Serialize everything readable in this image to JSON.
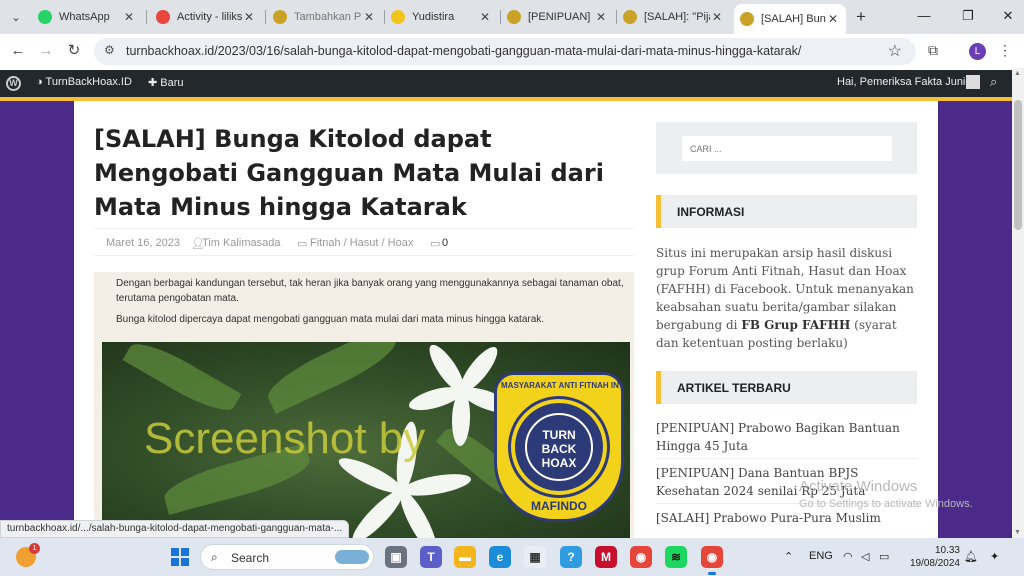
{
  "browser": {
    "tabs": [
      {
        "title": "WhatsApp",
        "favicon_color": "#25d366",
        "active": false
      },
      {
        "title": "Activity - liliks",
        "favicon_color": "#e8453c",
        "active": false
      },
      {
        "title": "Tambahkan P",
        "favicon_color": "#c9a227",
        "active": false
      },
      {
        "title": "Yudistira",
        "favicon_color": "#f2c31b",
        "active": false
      },
      {
        "title": "[PENIPUAN] P",
        "favicon_color": "#c9a227",
        "active": false
      },
      {
        "title": "[SALAH]: \"Pija",
        "favicon_color": "#c9a227",
        "active": false
      },
      {
        "title": "[SALAH] Bung",
        "favicon_color": "#c9a227",
        "active": true
      }
    ],
    "url": "turnbackhoax.id/2023/03/16/salah-bunga-kitolod-dapat-mengobati-gangguan-mata-mulai-dari-mata-minus-hingga-katarak/",
    "profile_initial": "L",
    "status_url": "turnbackhoax.id/.../salah-bunga-kitolod-dapat-mengobati-gangguan-mata-..."
  },
  "adminbar": {
    "site": "TurnBackHoax.ID",
    "new": "Baru",
    "greeting": "Hai, Pemeriksa Fakta Junior"
  },
  "article": {
    "title": "[SALAH] Bunga Kitolod dapat Mengobati Gangguan Mata Mulai dari Mata Minus hingga Katarak",
    "date": "Maret 16, 2023",
    "author": "Tim Kalimasada",
    "category": "Fitnah / Hasut / Hoax",
    "comments": "0",
    "figure_text": [
      "Dengan berbagai kandungan tersebut, tak heran jika banyak orang  yang menggunakannya sebagai tanaman obat, terutama pengobatan mata.",
      "Bunga kitolod dipercaya dapat mengobati gangguan mata mulai dari mata minus hingga katarak."
    ],
    "watermark": "Screenshot by",
    "badge": {
      "arc_text": "MASYARAKAT ANTI FITNAH INDONESIA",
      "center_lines": [
        "TURN",
        "BACK",
        "HOAX"
      ],
      "brand": "MAFINDO"
    }
  },
  "sidebar": {
    "search_placeholder": "CARI ...",
    "info_title": "INFORMASI",
    "info_text_before": "Situs ini merupakan arsip hasil diskusi grup Forum Anti Fitnah, Hasut dan Hoax (FAFHH) di Facebook. Untuk menanyakan keabsahan suatu berita/gambar silakan bergabung di ",
    "info_link": "FB Grup FAFHH",
    "info_text_after": " (syarat dan ketentuan posting berlaku)",
    "recent_title": "ARTIKEL TERBARU",
    "recent": [
      "[PENIPUAN] Prabowo Bagikan Bantuan Hingga 45 Juta",
      "[PENIPUAN] Dana Bantuan BPJS Kesehatan 2024 senilai Rp 25 Juta",
      "[SALAH] Prabowo Pura-Pura Muslim"
    ]
  },
  "windows": {
    "activate_title": "Activate Windows",
    "activate_sub": "Go to Settings to activate Windows.",
    "search_label": "Search",
    "lang": "ENG",
    "time": "10.33",
    "date": "19/08/2024",
    "weather_badge": "1"
  }
}
